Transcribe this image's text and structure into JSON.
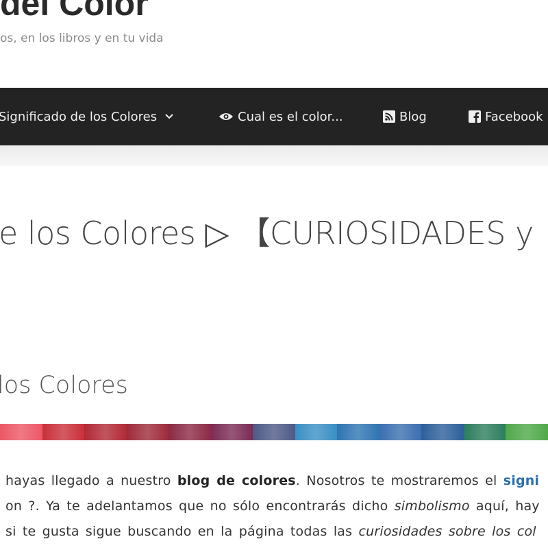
{
  "header": {
    "site_title": "del Color",
    "tagline": "os, en los libros y en tu vida"
  },
  "nav": {
    "items": [
      {
        "label": "Significado de los Colores",
        "icon": "chevron-down-icon"
      },
      {
        "label": "Cual es el color...",
        "icon": "eye-icon"
      },
      {
        "label": "Blog",
        "icon": "rss-icon"
      },
      {
        "label": "Facebook",
        "icon": "facebook-icon"
      }
    ]
  },
  "main": {
    "page_title": "e los Colores ▷ 【CURIOSIDADES y",
    "section_title": "los Colores",
    "paragraph": {
      "line1_a": "hayas llegado a nuestro ",
      "line1_b": "blog de colores",
      "line1_c": ". Nosotros te mostraremos el ",
      "line1_link": "signi",
      "line2_a": "on ?. Ya te adelantamos que no sólo encontrarás dicho ",
      "line2_b": "simbolismo",
      "line2_c": " aquí, hay",
      "line3_a": "si te gusta sigue buscando en la página todas las ",
      "line3_b": "curiosidades sobre los col"
    }
  },
  "colors": {
    "nav_bg": "#232323",
    "link": "#2a6fb0",
    "strip": [
      "#ec5766",
      "#c9303a",
      "#b12a36",
      "#9e2b3a",
      "#8b2a45",
      "#7b2c55",
      "#4e5a86",
      "#3a8fc4",
      "#2f75b2",
      "#3b6fb0",
      "#2d5f9a",
      "#2c7d5e",
      "#4fa84a"
    ]
  }
}
